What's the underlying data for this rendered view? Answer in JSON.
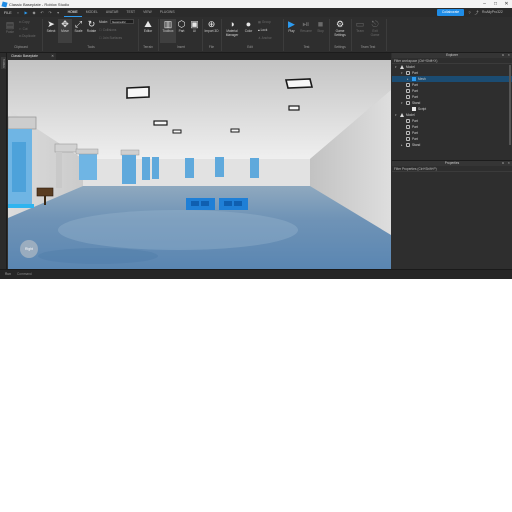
{
  "window": {
    "title": "Classic Baseplate - Roblox Studio"
  },
  "menubar": {
    "file": "FILE",
    "tabs": [
      "HOME",
      "MODEL",
      "AVATAR",
      "TEST",
      "VIEW",
      "PLUGINS"
    ],
    "collaborate": "Collaborate",
    "user": "RoAllyPro322"
  },
  "ribbon": {
    "clipboard": {
      "paste": "Paste",
      "copy": "Copy",
      "cut": "Cut",
      "duplicate": "Duplicate",
      "label": "Clipboard"
    },
    "tools": {
      "select": "Select",
      "move": "Move",
      "scale": "Scale",
      "rotate": "Rotate",
      "mode_label": "Mode:",
      "mode_value": "Geometric",
      "collisions": "Collisions",
      "join_surfaces": "Join Surfaces",
      "label": "Tools"
    },
    "terrain": {
      "editor": "Editor",
      "label": "Terrain"
    },
    "insert": {
      "toolbox": "Toolbox",
      "part": "Part",
      "ui": "UI",
      "label": "Insert"
    },
    "file": {
      "import3d": "Import 3D",
      "label": "File"
    },
    "edit": {
      "material_manager": "Material Manager",
      "color": "Color",
      "group": "Group",
      "lock": "Lock",
      "anchor": "Anchor",
      "label": "Edit"
    },
    "test": {
      "play": "Play",
      "resume": "Resume",
      "stop": "Stop",
      "label": "Test"
    },
    "settings": {
      "game_settings": "Game Settings",
      "label": "Settings"
    },
    "team_test": {
      "team": "Team",
      "exit_game": "Exit Game",
      "label": "Team Test"
    }
  },
  "left_strip": {
    "tab": "Toolbox"
  },
  "doc_tab": {
    "label": "Classic Baseplate"
  },
  "viewport": {
    "overlay_label": "Right"
  },
  "explorer": {
    "title": "Explorer",
    "filter": "Filter workspace (Ctrl+Shift+X)",
    "rows": [
      {
        "depth": 0,
        "expanded": true,
        "icon": "model",
        "label": "Model"
      },
      {
        "depth": 1,
        "expanded": true,
        "icon": "part",
        "label": "Part"
      },
      {
        "depth": 2,
        "expanded": false,
        "icon": "mesh",
        "label": "Mesh",
        "highlight": true
      },
      {
        "depth": 1,
        "expanded": null,
        "icon": "part",
        "label": "Part"
      },
      {
        "depth": 1,
        "expanded": null,
        "icon": "part",
        "label": "Part"
      },
      {
        "depth": 1,
        "expanded": null,
        "icon": "part",
        "label": "Part"
      },
      {
        "depth": 1,
        "expanded": true,
        "icon": "part",
        "label": "Stand"
      },
      {
        "depth": 2,
        "expanded": null,
        "icon": "script",
        "label": "Script"
      },
      {
        "depth": 0,
        "expanded": true,
        "icon": "model",
        "label": "Model"
      },
      {
        "depth": 1,
        "expanded": null,
        "icon": "part",
        "label": "Part"
      },
      {
        "depth": 1,
        "expanded": null,
        "icon": "part",
        "label": "Part"
      },
      {
        "depth": 1,
        "expanded": null,
        "icon": "part",
        "label": "Part"
      },
      {
        "depth": 1,
        "expanded": null,
        "icon": "part",
        "label": "Part"
      },
      {
        "depth": 1,
        "expanded": false,
        "icon": "part",
        "label": "Stand"
      }
    ]
  },
  "properties": {
    "title": "Properties",
    "filter": "Filter Properties (Ctrl+Shift+P)"
  },
  "statusbar": {
    "run": "Run",
    "command_placeholder": "Command"
  },
  "colors": {
    "accent": "#1F8CE6",
    "play": "#2C9BF0",
    "selection": "#1B4C72"
  }
}
